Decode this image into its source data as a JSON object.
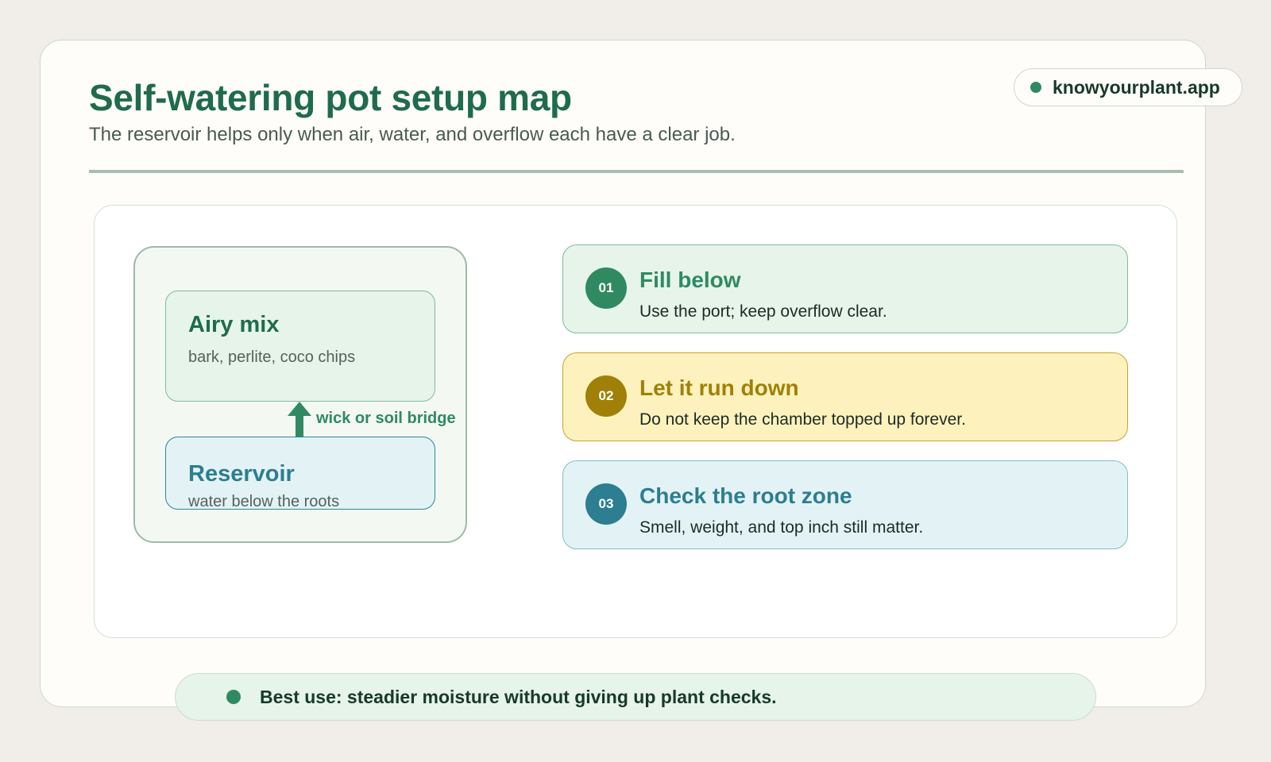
{
  "header": {
    "title": "Self-watering pot setup map",
    "subtitle": "The reservoir helps only when air, water, and overflow each have a clear job.",
    "brand": "knowyourplant.app"
  },
  "diagram": {
    "mix": {
      "title": "Airy mix",
      "detail": "bark, perlite, coco chips"
    },
    "connector": "wick or soil bridge",
    "reservoir": {
      "title": "Reservoir",
      "detail": "water below the roots"
    }
  },
  "steps": [
    {
      "number": "01",
      "title": "Fill below",
      "detail": "Use the port; keep overflow clear."
    },
    {
      "number": "02",
      "title": "Let it run down",
      "detail": "Do not keep the chamber topped up forever."
    },
    {
      "number": "03",
      "title": "Check the root zone",
      "detail": "Smell, weight, and top inch still matter."
    }
  ],
  "footer": {
    "text": "Best use: steadier moisture without giving up plant checks."
  },
  "colors": {
    "green": "#2f8a62",
    "amber": "#a08008",
    "teal": "#2c7e90",
    "background": "#f1ede8"
  }
}
